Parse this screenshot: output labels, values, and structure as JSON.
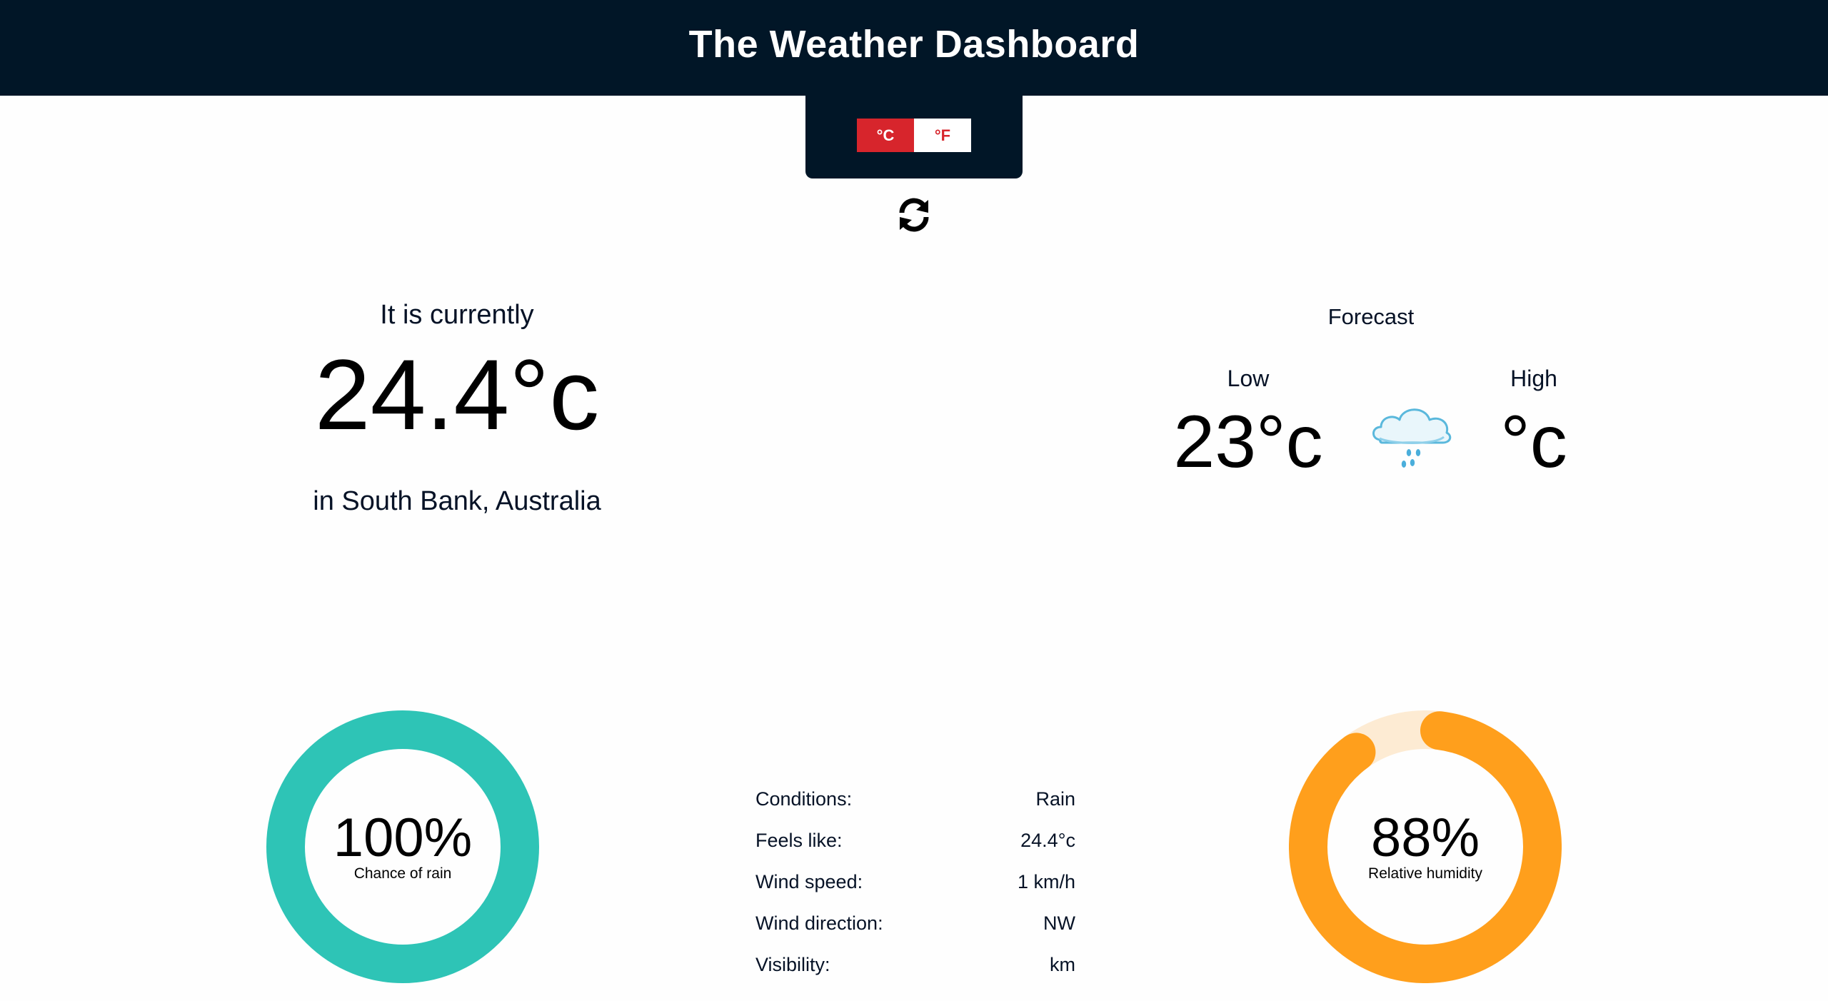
{
  "header": {
    "title": "The Weather Dashboard"
  },
  "units": {
    "celsius_label": "°C",
    "fahrenheit_label": "°F",
    "selected": "°C"
  },
  "refresh": {
    "icon": "refresh-icon"
  },
  "current": {
    "label": "It is currently",
    "temperature": "24.4°c",
    "location": "in South Bank, Australia"
  },
  "forecast": {
    "title": "Forecast",
    "low_label": "Low",
    "low_value": "23°c",
    "high_label": "High",
    "high_value": "°c",
    "icon": "rain-cloud-icon"
  },
  "rain": {
    "value": "100%",
    "caption": "Chance of rain",
    "fraction": 1.0,
    "color": "#2ec4b6"
  },
  "humidity": {
    "value": "88%",
    "caption": "Relative humidity",
    "fraction": 0.88,
    "color": "#ff9f1c",
    "track_color": "#fdebd3"
  },
  "details": [
    {
      "label": "Conditions:",
      "value": "Rain"
    },
    {
      "label": "Feels like:",
      "value": "24.4°c"
    },
    {
      "label": "Wind speed:",
      "value": "1 km/h"
    },
    {
      "label": "Wind direction:",
      "value": "NW"
    },
    {
      "label": "Visibility:",
      "value": "km"
    }
  ],
  "colors": {
    "header_bg": "#011627",
    "accent_red": "#d7252c"
  }
}
